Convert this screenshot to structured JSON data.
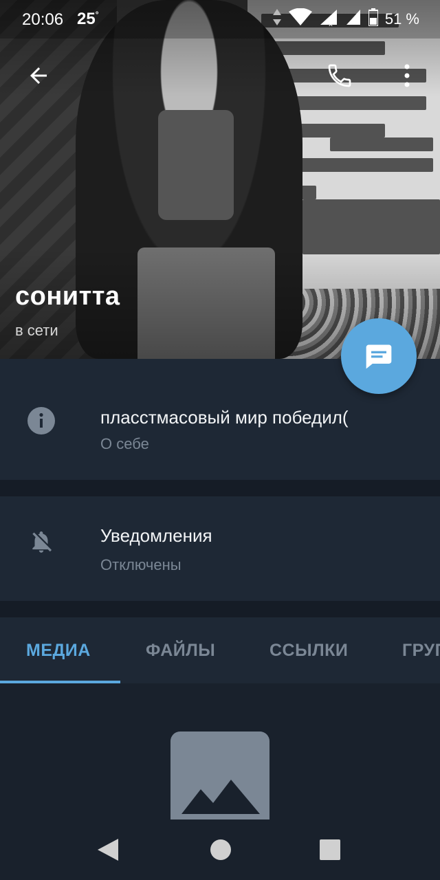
{
  "status_bar": {
    "time": "20:06",
    "temperature": "25",
    "temperature_unit": "°",
    "battery": "51 %"
  },
  "profile": {
    "name": "сонитта",
    "status": "в сети"
  },
  "about": {
    "text": "пласстмасовый мир победил(",
    "label": "О себе"
  },
  "notifications": {
    "title": "Уведомления",
    "value": "Отключены"
  },
  "tabs": [
    {
      "label": "МЕДИА",
      "active": true
    },
    {
      "label": "ФАЙЛЫ",
      "active": false
    },
    {
      "label": "ССЫЛКИ",
      "active": false
    },
    {
      "label": "ГРУППЫ",
      "active": false
    }
  ],
  "colors": {
    "accent": "#5ba8de",
    "panel": "#1e2835",
    "background": "#19212c",
    "muted_text": "#7b8795"
  },
  "icons": [
    "back-arrow-icon",
    "phone-icon",
    "more-vert-icon",
    "chat-bubble-icon",
    "info-icon",
    "bell-off-icon",
    "image-placeholder-icon",
    "nav-back-icon",
    "nav-home-icon",
    "nav-recents-icon"
  ]
}
